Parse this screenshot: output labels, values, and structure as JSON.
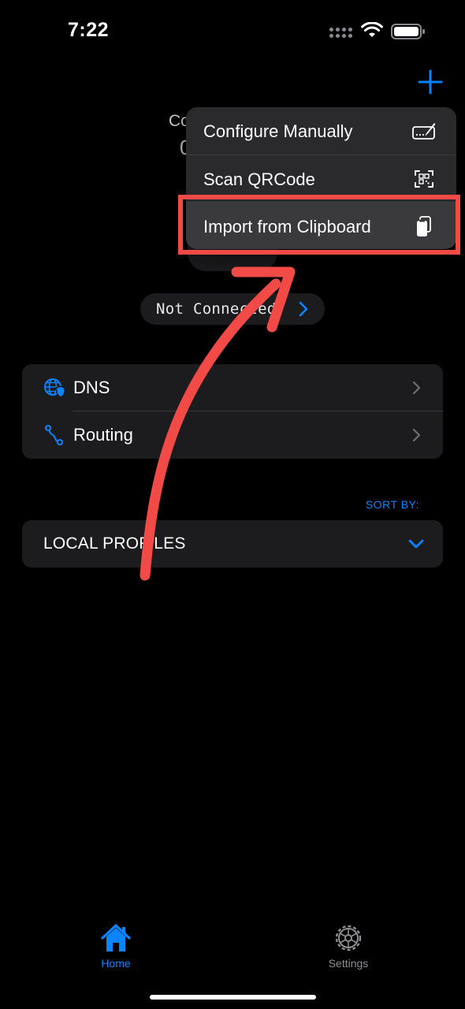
{
  "status_bar": {
    "time": "7:22",
    "icons": [
      "cellular-icon",
      "wifi-icon",
      "battery-icon"
    ]
  },
  "header": {
    "add_icon": "plus-icon"
  },
  "connection": {
    "label_peek": "Co",
    "value_peek": "0",
    "status_text": "Not Connected"
  },
  "settings_list": {
    "items": [
      {
        "label": "DNS",
        "icon": "globe-shield-icon"
      },
      {
        "label": "Routing",
        "icon": "route-icon"
      }
    ]
  },
  "profiles": {
    "sort_by_label": "SORT BY:",
    "section_label": "LOCAL PROFILES"
  },
  "menu": {
    "items": [
      {
        "label": "Configure Manually",
        "icon": "signature-icon"
      },
      {
        "label": "Scan QRCode",
        "icon": "qrcode-viewfinder-icon"
      },
      {
        "label": "Import from Clipboard",
        "icon": "clipboard-icon"
      }
    ]
  },
  "tab_bar": {
    "tabs": [
      {
        "label": "Home",
        "icon": "house-icon",
        "selected": true
      },
      {
        "label": "Settings",
        "icon": "gear-icon",
        "selected": false
      }
    ]
  },
  "colors": {
    "accent": "#0a84ff",
    "annotation": "#f24a46",
    "card": "#1c1c1e",
    "menu": "#2a2a2c"
  }
}
